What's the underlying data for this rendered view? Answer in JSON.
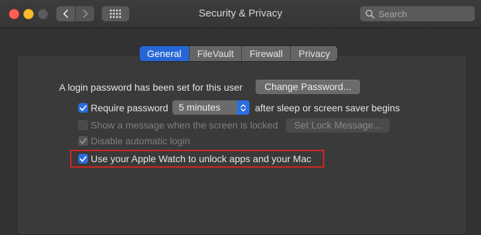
{
  "window": {
    "title": "Security & Privacy"
  },
  "search": {
    "placeholder": "Search"
  },
  "tabs": [
    {
      "label": "General",
      "active": true
    },
    {
      "label": "FileVault",
      "active": false
    },
    {
      "label": "Firewall",
      "active": false
    },
    {
      "label": "Privacy",
      "active": false
    }
  ],
  "general": {
    "login_text": "A login password has been set for this user",
    "change_password_label": "Change Password...",
    "require_password": {
      "label": "Require password",
      "checked": true
    },
    "require_select_value": "5 minutes",
    "after_sleep_text": "after sleep or screen saver begins",
    "show_message": {
      "label": "Show a message when the screen is locked",
      "checked": false,
      "enabled": false
    },
    "set_lock_message_label": "Set Lock Message...",
    "disable_auto_login": {
      "label": "Disable automatic login",
      "checked": true,
      "enabled": false
    },
    "apple_watch": {
      "label": "Use your Apple Watch to unlock apps and your Mac",
      "checked": true
    }
  },
  "colors": {
    "accent": "#2767d5",
    "highlight_border": "#d42424",
    "close": "#fe5f57",
    "minimize": "#febc2e"
  },
  "icons": [
    "back-chevron-icon",
    "forward-chevron-icon",
    "grid-icon",
    "search-icon",
    "checkmark-icon",
    "up-down-chevron-icon"
  ]
}
